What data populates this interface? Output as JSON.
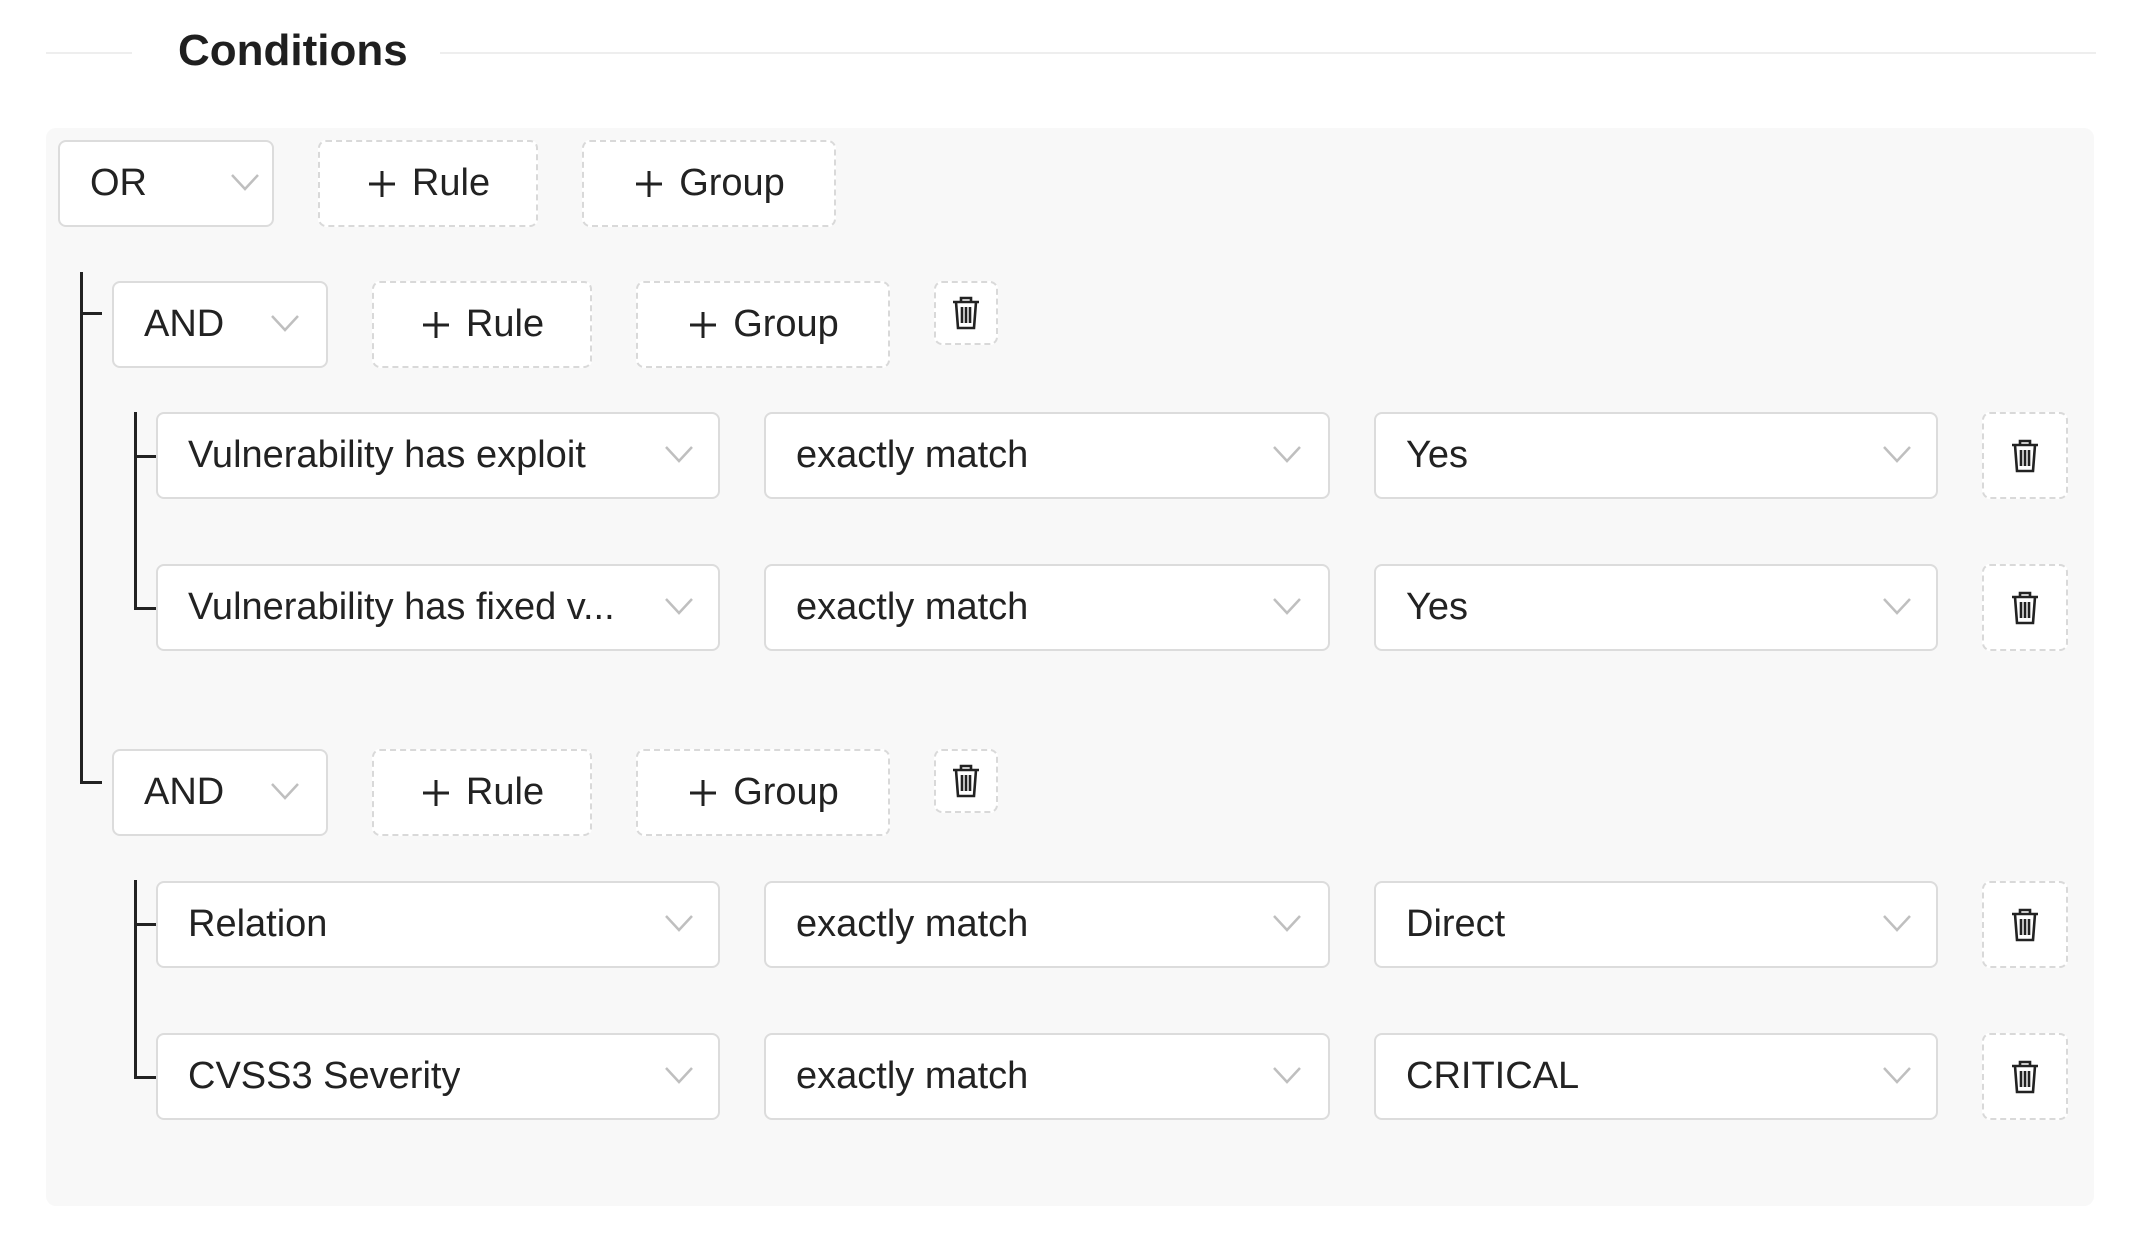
{
  "section": {
    "title": "Conditions"
  },
  "root": {
    "operator": "OR",
    "add_rule_label": "Rule",
    "add_group_label": "Group"
  },
  "groups": [
    {
      "operator": "AND",
      "add_rule_label": "Rule",
      "add_group_label": "Group",
      "rules": [
        {
          "field": "Vulnerability has exploit",
          "operator": "exactly match",
          "value": "Yes"
        },
        {
          "field": "Vulnerability has fixed v...",
          "operator": "exactly match",
          "value": "Yes"
        }
      ]
    },
    {
      "operator": "AND",
      "add_rule_label": "Rule",
      "add_group_label": "Group",
      "rules": [
        {
          "field": "Relation",
          "operator": "exactly match",
          "value": "Direct"
        },
        {
          "field": "CVSS3 Severity",
          "operator": "exactly match",
          "value": "CRITICAL"
        }
      ]
    }
  ],
  "icons": {
    "chevron": "chevron-down-icon",
    "plus": "plus-icon",
    "delete": "trash-icon"
  },
  "colors": {
    "panel_bg": "#f8f8f8",
    "border": "#dcdcdc",
    "text": "#222222"
  }
}
